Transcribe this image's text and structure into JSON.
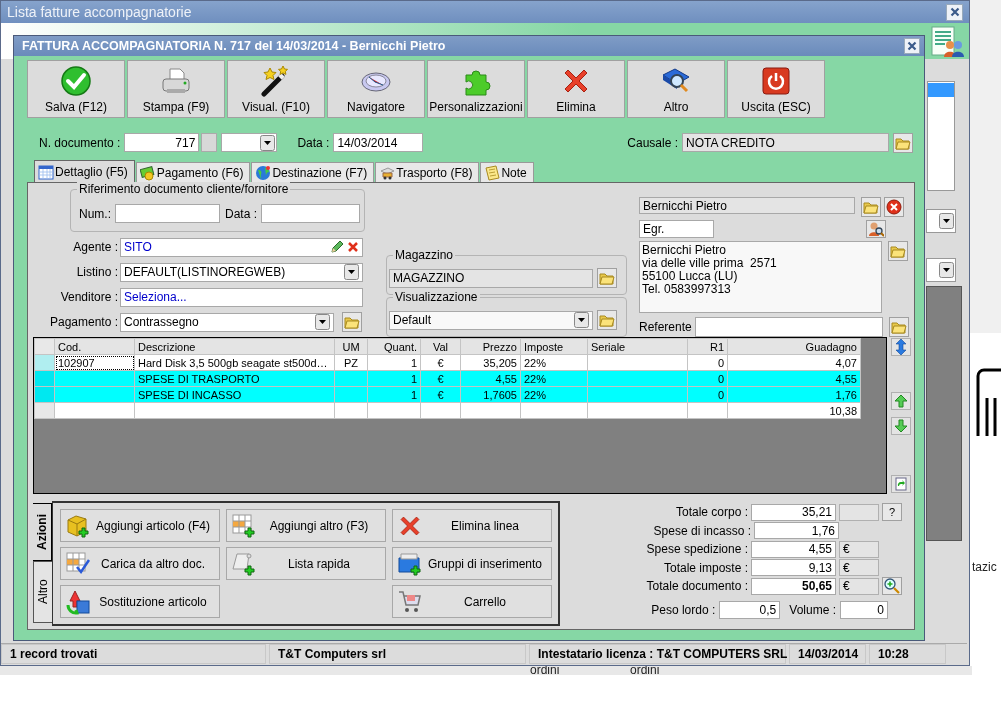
{
  "main_window": {
    "title": "Lista fatture accompagnatorie"
  },
  "dialog": {
    "title": "FATTURA ACCOMPAGNATORIA N. 717 del 14/03/2014 - Bernicchi Pietro"
  },
  "toolbar": [
    {
      "label": "Salva (F12)"
    },
    {
      "label": "Stampa (F9)"
    },
    {
      "label": "Visual. (F10)"
    },
    {
      "label": "Navigatore"
    },
    {
      "label": "Personalizzazioni"
    },
    {
      "label": "Elimina"
    },
    {
      "label": "Altro"
    },
    {
      "label": "Uscita (ESC)"
    }
  ],
  "header": {
    "doc_number_label": "N. documento :",
    "doc_number": "717",
    "date_label": "Data :",
    "date": "14/03/2014",
    "causale_label": "Causale :",
    "causale": "NOTA CREDITO"
  },
  "tabs": [
    {
      "label": "Dettaglio (F5)",
      "selected": true
    },
    {
      "label": "Pagamento (F6)",
      "selected": false
    },
    {
      "label": "Destinazione (F7)",
      "selected": false
    },
    {
      "label": "Trasporto (F8)",
      "selected": false
    },
    {
      "label": "Note",
      "selected": false
    }
  ],
  "reference": {
    "title": "Riferimento documento cliente/fornitore",
    "num_label": "Num.:",
    "date_label": "Data :"
  },
  "fields": [
    {
      "label": "Agente :",
      "value": "SITO",
      "kind": "agent"
    },
    {
      "label": "Listino :",
      "value": "DEFAULT(LISTINOREGWEB)",
      "kind": "combo"
    },
    {
      "label": "Venditore :",
      "value": "Seleziona...",
      "kind": "link"
    },
    {
      "label": "Pagamento :",
      "value": "Contrassegno",
      "kind": "combo-folder"
    }
  ],
  "magazzino": {
    "title": "Magazzino",
    "value": "MAGAZZINO"
  },
  "visualizzazione": {
    "title": "Visualizzazione",
    "value": "Default"
  },
  "customer": {
    "name": "Bernicchi Pietro",
    "salutation": "Egr.",
    "address": [
      "Bernicchi Pietro",
      "via delle ville prima  2571",
      "55100 Lucca (LU)",
      "Tel. 0583997313"
    ],
    "referente_label": "Referente"
  },
  "table": {
    "columns": [
      "Cod.",
      "Descrizione",
      "UM",
      "Quant.",
      "Val",
      "Prezzo",
      "Imposte",
      "Seriale",
      "R1",
      "Guadagno"
    ],
    "rows": [
      {
        "selected": true,
        "highlighted": false,
        "cells": [
          "102907",
          "Hard Disk 3,5  500gb seagate st500d…",
          "PZ",
          "1",
          "€",
          "35,205",
          "22%",
          null,
          "0",
          "4,07"
        ]
      },
      {
        "selected": false,
        "highlighted": true,
        "cells": [
          null,
          "SPESE DI TRASPORTO",
          null,
          "1",
          "€",
          "4,55",
          "22%",
          null,
          "0",
          "4,55"
        ]
      },
      {
        "selected": false,
        "highlighted": true,
        "cells": [
          null,
          "SPESE DI INCASSO",
          null,
          "1",
          "€",
          "1,7605",
          "22%",
          null,
          "0",
          "1,76"
        ]
      }
    ],
    "total": "10,38"
  },
  "action_tabs": [
    {
      "label": "Azioni",
      "selected": true
    },
    {
      "label": "Altro",
      "selected": false
    }
  ],
  "actions": [
    [
      "Aggiungi articolo (F4)",
      "Carica da altro doc.",
      "Sostituzione articolo"
    ],
    [
      "Aggiungi altro (F3)",
      "Lista rapida"
    ],
    [
      "Elimina linea",
      "Gruppi di inserimento",
      "Carrello"
    ]
  ],
  "totals": [
    {
      "label": "Totale corpo :",
      "value": "35,21",
      "kind": "help",
      "button": "?"
    },
    {
      "label": "Spese di incasso :",
      "value": "1,76",
      "kind": "plain"
    },
    {
      "label": "Spese spedizione :",
      "value": "4,55",
      "kind": "currency",
      "unit": "€"
    },
    {
      "label": "Totale imposte :",
      "value": "9,13",
      "kind": "currency",
      "unit": "€"
    },
    {
      "label": "Totale documento :",
      "value": "50,65",
      "kind": "grand",
      "unit": "€"
    }
  ],
  "weights": [
    {
      "label": "Peso lordo :",
      "value": "0,5"
    },
    {
      "label": "Volume :",
      "value": "0"
    }
  ],
  "status_bar": [
    "1 record trovati",
    "T&T Computers srl",
    "Intestatario licenza : T&T COMPUTERS SRL",
    "14/03/2014",
    "10:28"
  ],
  "behind": {
    "labels": [
      "ordini",
      "ordini"
    ],
    "side_text": "tazic"
  }
}
